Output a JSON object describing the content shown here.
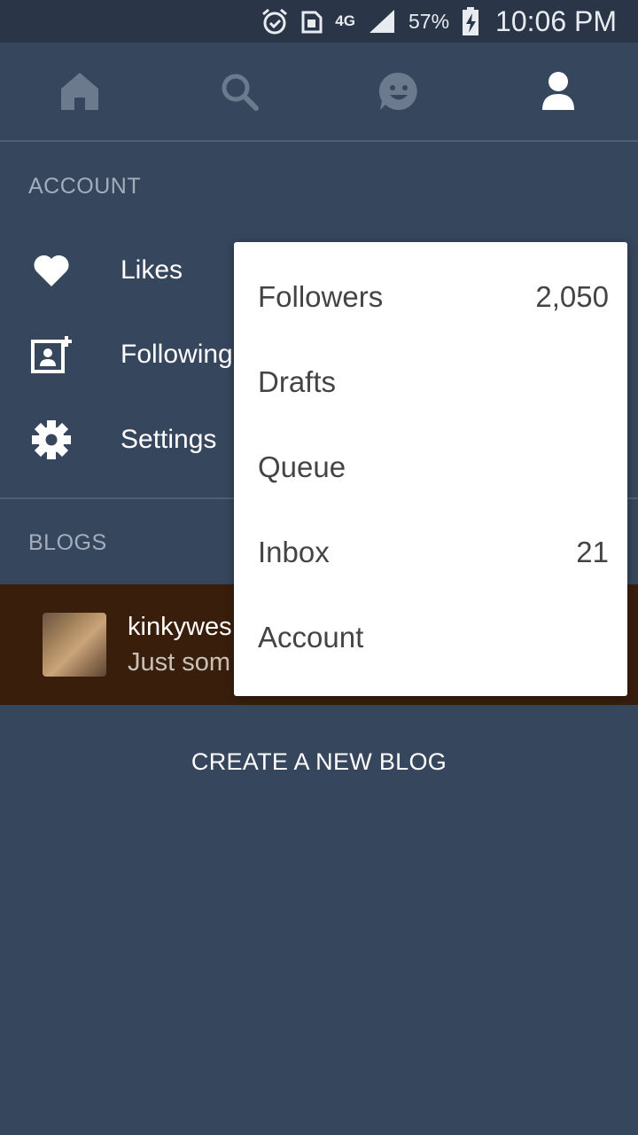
{
  "status_bar": {
    "network": "4G",
    "battery_percent": "57%",
    "time": "10:06 PM",
    "icons": [
      "alarm-icon",
      "sim-lock-icon",
      "4g-data-icon",
      "signal-icon",
      "battery-charging-icon"
    ]
  },
  "top_nav": {
    "tabs": [
      {
        "icon": "home-icon",
        "active": false
      },
      {
        "icon": "search-icon",
        "active": false
      },
      {
        "icon": "activity-face-icon",
        "active": false
      },
      {
        "icon": "account-person-icon",
        "active": true
      }
    ]
  },
  "account": {
    "header": "ACCOUNT",
    "items": [
      {
        "label": "Likes",
        "icon": "heart-icon"
      },
      {
        "label": "Following",
        "icon": "following-icon"
      },
      {
        "label": "Settings",
        "icon": "gear-icon"
      }
    ]
  },
  "blogs": {
    "header": "BLOGS",
    "items": [
      {
        "name": "kinkywes",
        "description": "Just som"
      }
    ],
    "create_label": "CREATE A NEW BLOG"
  },
  "popup_menu": {
    "items": [
      {
        "label": "Followers",
        "count": "2,050"
      },
      {
        "label": "Drafts",
        "count": ""
      },
      {
        "label": "Queue",
        "count": ""
      },
      {
        "label": "Inbox",
        "count": "21"
      },
      {
        "label": "Account",
        "count": ""
      }
    ]
  },
  "colors": {
    "background": "#36465d",
    "status_bar": "#2a3648",
    "blog_row": "#3a1e0c",
    "inactive_icon": "#6c7a8e",
    "popup_background": "#ffffff"
  }
}
